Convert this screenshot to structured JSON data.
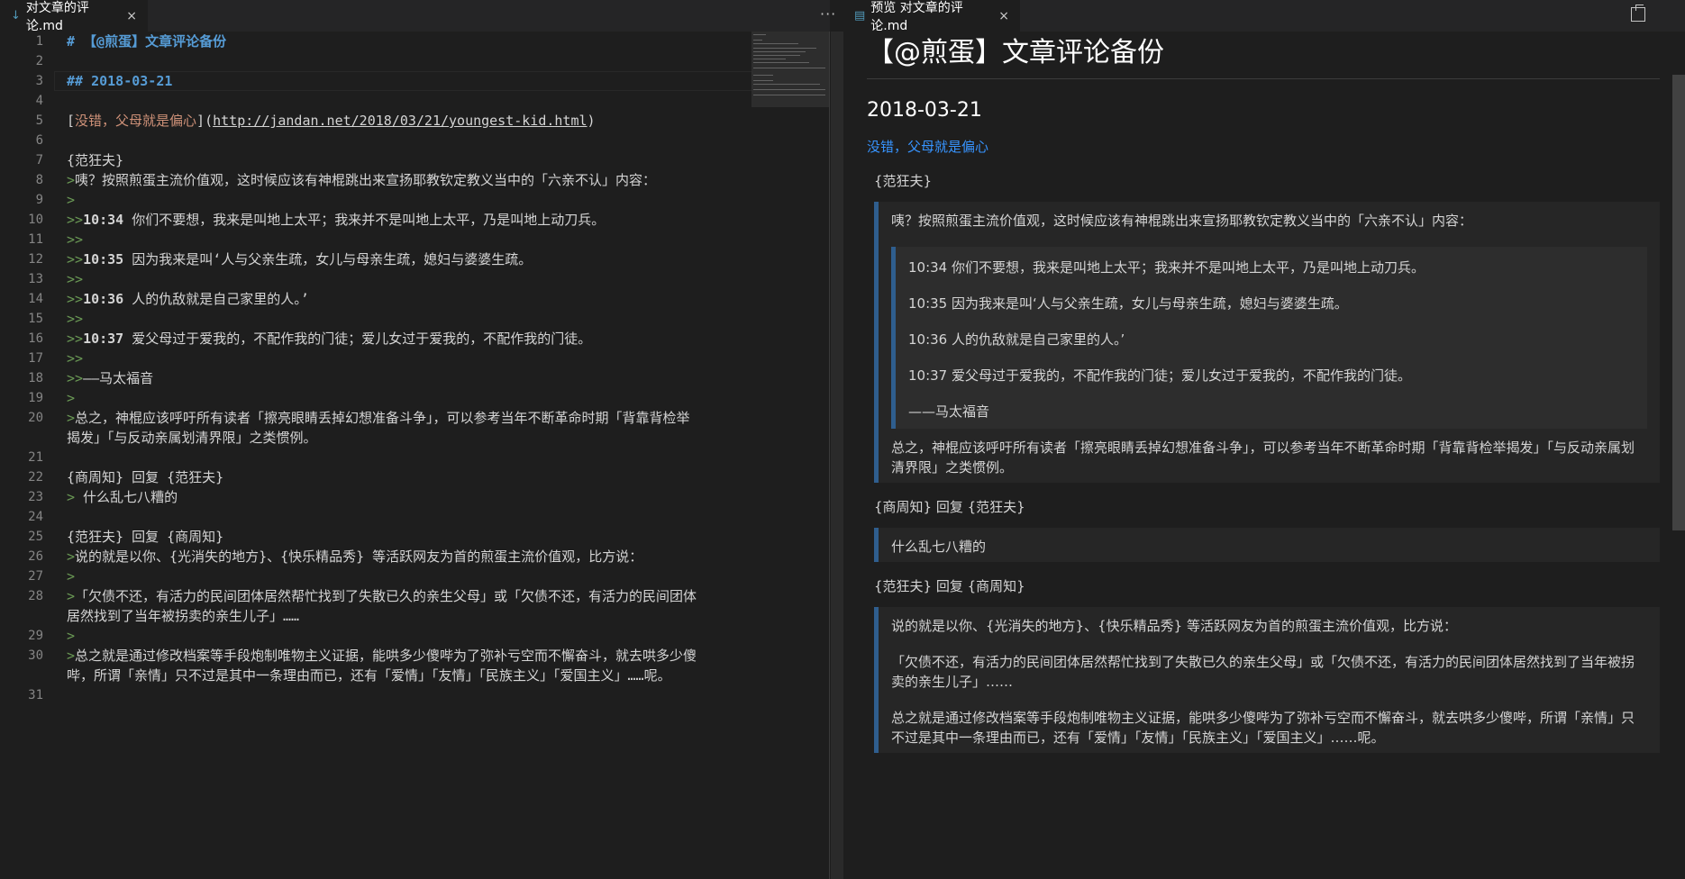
{
  "left_tab": {
    "icon": "markdown-icon",
    "label": "对文章的评论.md",
    "close": "×"
  },
  "left_more": "···",
  "right_tab": {
    "label": "预览 对文章的评论.md",
    "close": "×"
  },
  "editor_lines": [
    {
      "n": "1",
      "segs": [
        {
          "t": "# 【@煎蛋】文章评论备份",
          "c": "h-mark"
        }
      ]
    },
    {
      "n": "2",
      "segs": []
    },
    {
      "n": "3",
      "segs": [
        {
          "t": "## 2018-03-21",
          "c": "h-mark"
        }
      ]
    },
    {
      "n": "4",
      "segs": []
    },
    {
      "n": "5",
      "segs": [
        {
          "t": "[",
          "c": ""
        },
        {
          "t": "没错，父母就是偏心",
          "c": "link-text"
        },
        {
          "t": "](",
          "c": ""
        },
        {
          "t": "http://jandan.net/2018/03/21/youngest-kid.html",
          "c": "url"
        },
        {
          "t": ")",
          "c": ""
        }
      ]
    },
    {
      "n": "6",
      "segs": []
    },
    {
      "n": "7",
      "segs": [
        {
          "t": "{范狂夫}",
          "c": ""
        }
      ]
    },
    {
      "n": "8",
      "segs": [
        {
          "t": ">",
          "c": "q"
        },
        {
          "t": "咦？按照煎蛋主流价值观，这时候应该有神棍跳出来宣扬耶教钦定教义当中的「六亲不认」内容：",
          "c": ""
        }
      ]
    },
    {
      "n": "9",
      "segs": [
        {
          "t": ">",
          "c": "q"
        }
      ]
    },
    {
      "n": "10",
      "segs": [
        {
          "t": ">>",
          "c": "q"
        },
        {
          "t": "10:34",
          "c": "ts"
        },
        {
          "t": " 你们不要想，我来是叫地上太平；我来并不是叫地上太平，乃是叫地上动刀兵。",
          "c": ""
        }
      ]
    },
    {
      "n": "11",
      "segs": [
        {
          "t": ">>",
          "c": "q"
        }
      ]
    },
    {
      "n": "12",
      "segs": [
        {
          "t": ">>",
          "c": "q"
        },
        {
          "t": "10:35",
          "c": "ts"
        },
        {
          "t": " 因为我来是叫‘人与父亲生疏，女儿与母亲生疏，媳妇与婆婆生疏。",
          "c": ""
        }
      ]
    },
    {
      "n": "13",
      "segs": [
        {
          "t": ">>",
          "c": "q"
        }
      ]
    },
    {
      "n": "14",
      "segs": [
        {
          "t": ">>",
          "c": "q"
        },
        {
          "t": "10:36",
          "c": "ts"
        },
        {
          "t": " 人的仇敌就是自己家里的人。’",
          "c": ""
        }
      ]
    },
    {
      "n": "15",
      "segs": [
        {
          "t": ">>",
          "c": "q"
        }
      ]
    },
    {
      "n": "16",
      "segs": [
        {
          "t": ">>",
          "c": "q"
        },
        {
          "t": "10:37",
          "c": "ts"
        },
        {
          "t": " 爱父母过于爱我的，不配作我的门徒；爱儿女过于爱我的，不配作我的门徒。",
          "c": ""
        }
      ]
    },
    {
      "n": "17",
      "segs": [
        {
          "t": ">>",
          "c": "q"
        }
      ]
    },
    {
      "n": "18",
      "segs": [
        {
          "t": ">>",
          "c": "q"
        },
        {
          "t": "——马太福音",
          "c": ""
        }
      ]
    },
    {
      "n": "19",
      "segs": [
        {
          "t": ">",
          "c": "q"
        }
      ]
    },
    {
      "n": "20",
      "segs": [
        {
          "t": ">",
          "c": "q"
        },
        {
          "t": "总之，神棍应该呼吁所有读者「擦亮眼睛丢掉幻想准备斗争」，可以参考当年不断革命时期「背靠背检举",
          "c": ""
        }
      ],
      "wrap": "揭发」「与反动亲属划清界限」之类惯例。"
    },
    {
      "n": "21",
      "segs": []
    },
    {
      "n": "22",
      "segs": [
        {
          "t": "{商周知} 回复 {范狂夫}",
          "c": ""
        }
      ]
    },
    {
      "n": "23",
      "segs": [
        {
          "t": ">",
          "c": "q"
        },
        {
          "t": " 什么乱七八糟的",
          "c": ""
        }
      ]
    },
    {
      "n": "24",
      "segs": []
    },
    {
      "n": "25",
      "segs": [
        {
          "t": "{范狂夫} 回复 {商周知}",
          "c": ""
        }
      ]
    },
    {
      "n": "26",
      "segs": [
        {
          "t": ">",
          "c": "q"
        },
        {
          "t": "说的就是以你、{光消失的地方}、{快乐精品秀} 等活跃网友为首的煎蛋主流价值观，比方说：",
          "c": ""
        }
      ]
    },
    {
      "n": "27",
      "segs": [
        {
          "t": ">",
          "c": "q"
        }
      ]
    },
    {
      "n": "28",
      "segs": [
        {
          "t": ">",
          "c": "q"
        },
        {
          "t": "「欠债不还，有活力的民间团体居然帮忙找到了失散已久的亲生父母」或「欠债不还，有活力的民间团体",
          "c": ""
        }
      ],
      "wrap": "居然找到了当年被拐卖的亲生儿子」……"
    },
    {
      "n": "29",
      "segs": [
        {
          "t": ">",
          "c": "q"
        }
      ]
    },
    {
      "n": "30",
      "segs": [
        {
          "t": ">",
          "c": "q"
        },
        {
          "t": "总之就是通过修改档案等手段炮制唯物主义证据，能哄多少傻哔为了弥补亏空而不懈奋斗，就去哄多少傻",
          "c": ""
        }
      ],
      "wrap": "哔，所谓「亲情」只不过是其中一条理由而已，还有「爱情」「友情」「民族主义」「爱国主义」……呢。"
    },
    {
      "n": "31",
      "segs": []
    }
  ],
  "preview": {
    "h1": "【@煎蛋】文章评论备份",
    "h2": "2018-03-21",
    "link": "没错，父母就是偏心",
    "c1_author": "{范狂夫}",
    "c1_p1": "咦？按照煎蛋主流价值观，这时候应该有神棍跳出来宣扬耶教钦定教义当中的「六亲不认」内容：",
    "c1_q1": "10:34 你们不要想，我来是叫地上太平；我来并不是叫地上太平，乃是叫地上动刀兵。",
    "c1_q2": "10:35 因为我来是叫‘人与父亲生疏，女儿与母亲生疏，媳妇与婆婆生疏。",
    "c1_q3": "10:36 人的仇敌就是自己家里的人。’",
    "c1_q4": "10:37 爱父母过于爱我的，不配作我的门徒；爱儿女过于爱我的，不配作我的门徒。",
    "c1_q5": "——马太福音",
    "c1_p2": "总之，神棍应该呼吁所有读者「擦亮眼睛丢掉幻想准备斗争」，可以参考当年不断革命时期「背靠背检举揭发」「与反动亲属划清界限」之类惯例。",
    "c2_author": "{商周知} 回复 {范狂夫}",
    "c2_p1": "什么乱七八糟的",
    "c3_author": "{范狂夫} 回复 {商周知}",
    "c3_p1": "说的就是以你、{光消失的地方}、{快乐精品秀} 等活跃网友为首的煎蛋主流价值观，比方说：",
    "c3_p2": "「欠债不还，有活力的民间团体居然帮忙找到了失散已久的亲生父母」或「欠债不还，有活力的民间团体居然找到了当年被拐卖的亲生儿子」……",
    "c3_p3": "总之就是通过修改档案等手段炮制唯物主义证据，能哄多少傻哔为了弥补亏空而不懈奋斗，就去哄多少傻哔，所谓「亲情」只不过是其中一条理由而已，还有「爱情」「友情」「民族主义」「爱国主义」……呢。"
  }
}
